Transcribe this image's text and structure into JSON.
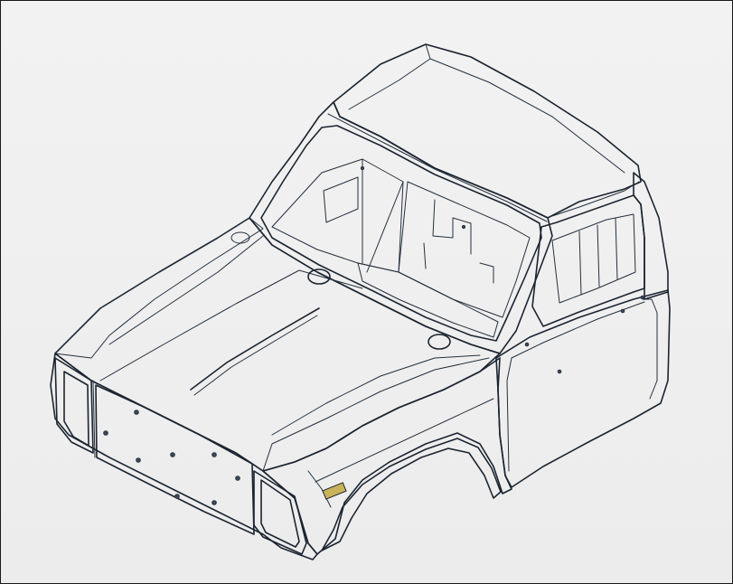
{
  "viewport": {
    "background": "#eeeeee",
    "border_color": "#1a1a1a"
  },
  "model": {
    "body_color": "#6b87a8",
    "body_highlight": "#8ea8c6",
    "body_shadow": "#3e5068",
    "side_dark": "#4b5d75",
    "glass_color": "#c9cdd1",
    "grille_color": "#b4b6b8",
    "marker_color": "#c8b25a",
    "edge_color": "#1b2430"
  }
}
